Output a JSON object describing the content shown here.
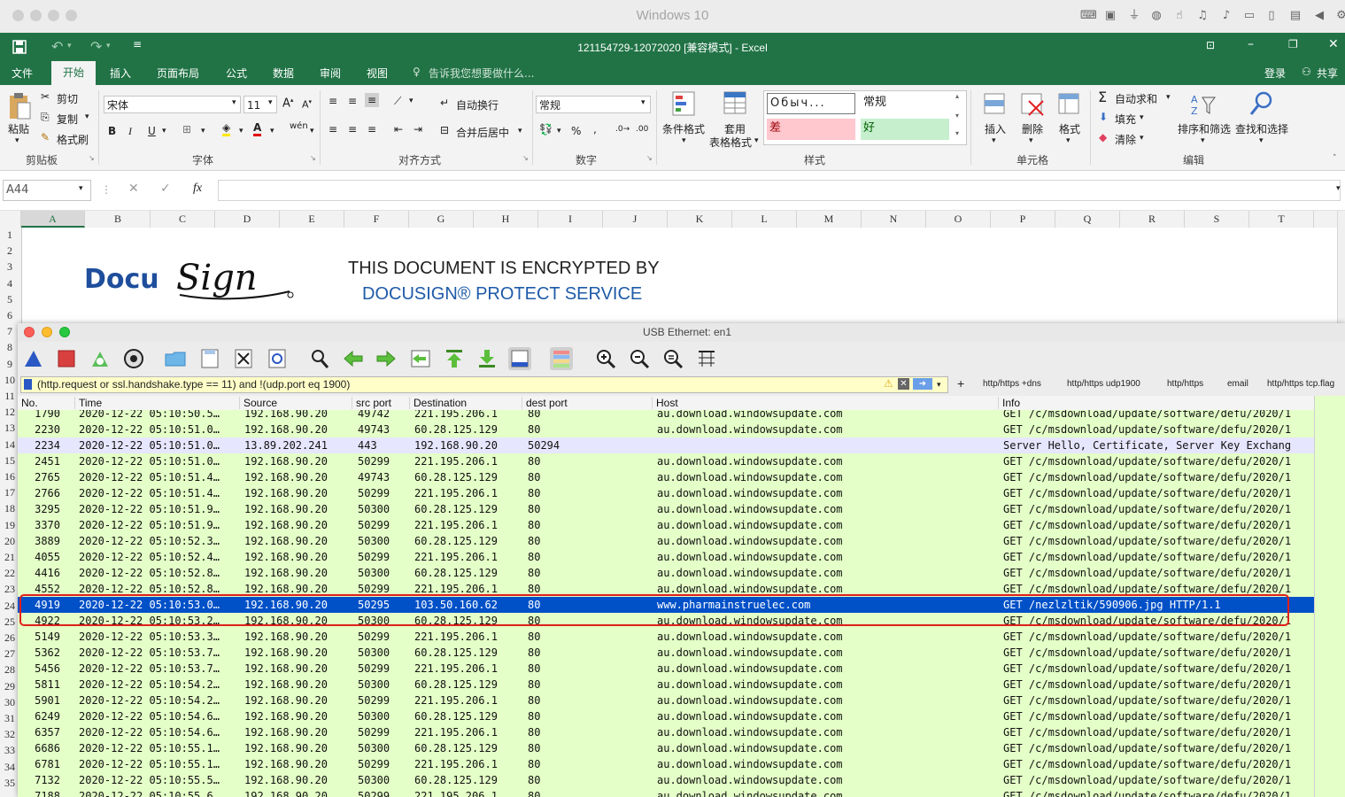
{
  "host": {
    "title": "Windows 10",
    "tray_icons": [
      "keyboard-icon",
      "cpu-icon",
      "usb-icon",
      "globe-icon",
      "touch-icon",
      "speaker-icon",
      "mic-icon",
      "tablet-icon",
      "display-icon",
      "folder-icon",
      "arrow-left-icon",
      "gear-icon"
    ]
  },
  "excel": {
    "window_title": "121154729-12072020  [兼容模式] - Excel",
    "tabs": [
      "文件",
      "开始",
      "插入",
      "页面布局",
      "公式",
      "数据",
      "审阅",
      "视图"
    ],
    "tell_me": "告诉我您想要做什么...",
    "login": "登录",
    "share": "共享",
    "ribbon": {
      "clipboard": {
        "paste": "粘贴",
        "cut": "剪切",
        "copy": "复制",
        "format_painter": "格式刷",
        "label": "剪贴板"
      },
      "font": {
        "name": "宋体",
        "size": "11",
        "bold": "B",
        "italic": "I",
        "underline": "U",
        "label": "字体"
      },
      "alignment": {
        "wrap": "自动换行",
        "merge": "合并后居中",
        "label": "对齐方式"
      },
      "number": {
        "format": "常规",
        "label": "数字"
      },
      "styles": {
        "conditional": "条件格式",
        "table_line1": "套用",
        "table_line2": "表格格式",
        "normal_ru": "Обыч...",
        "normal": "常规",
        "bad": "差",
        "good": "好",
        "label": "样式"
      },
      "cells": {
        "insert": "插入",
        "delete": "删除",
        "format": "格式",
        "label": "单元格"
      },
      "editing": {
        "autosum": "自动求和",
        "fill": "填充",
        "clear": "清除",
        "sort": "排序和筛选",
        "find": "查找和选择",
        "label": "编辑"
      }
    },
    "name_box": "A44",
    "fx": "fx",
    "columns": [
      "A",
      "B",
      "C",
      "D",
      "E",
      "F",
      "G",
      "H",
      "I",
      "J",
      "K",
      "L",
      "M",
      "N",
      "O",
      "P",
      "Q",
      "R",
      "S",
      "T"
    ],
    "rows": [
      "1",
      "2",
      "3",
      "4",
      "5",
      "6",
      "7",
      "8",
      "9",
      "10",
      "11",
      "12",
      "13",
      "14",
      "15",
      "16",
      "17",
      "18",
      "19",
      "20",
      "21",
      "22",
      "23",
      "24",
      "25",
      "26",
      "27",
      "28",
      "29",
      "30",
      "31",
      "32",
      "33",
      "34",
      "35"
    ],
    "docusign": {
      "logo_text": "DocuSign",
      "line1": "THIS DOCUMENT IS ENCRYPTED BY",
      "line2": "DOCUSIGN® PROTECT SERVICE"
    }
  },
  "wireshark": {
    "title": "USB Ethernet: en1",
    "filter": "(http.request or ssl.handshake.type == 11) and !(udp.port eq 1900)",
    "filter_buttons": [
      "http/https +dns",
      "http/https udp1900",
      "http/https",
      "email",
      "http/https tcp.flag"
    ],
    "columns": [
      "No.",
      "Time",
      "Source",
      "src port",
      "Destination",
      "dest port",
      "Host",
      "Info"
    ],
    "packets": [
      {
        "no": "1790",
        "time": "2020-12-22 05:10:50.5…",
        "src": "192.168.90.20",
        "sport": "49742",
        "dst": "221.195.206.1",
        "dport": "80",
        "host": "au.download.windowsupdate.com",
        "info": "GET /c/msdownload/update/software/defu/2020/1",
        "kind": "http"
      },
      {
        "no": "2230",
        "time": "2020-12-22 05:10:51.0…",
        "src": "192.168.90.20",
        "sport": "49743",
        "dst": "60.28.125.129",
        "dport": "80",
        "host": "au.download.windowsupdate.com",
        "info": "GET /c/msdownload/update/software/defu/2020/1",
        "kind": "http"
      },
      {
        "no": "2234",
        "time": "2020-12-22 05:10:51.0…",
        "src": "13.89.202.241",
        "sport": "443",
        "dst": "192.168.90.20",
        "dport": "50294",
        "host": "",
        "info": "Server Hello, Certificate, Server Key Exchang",
        "kind": "tls"
      },
      {
        "no": "2451",
        "time": "2020-12-22 05:10:51.0…",
        "src": "192.168.90.20",
        "sport": "50299",
        "dst": "221.195.206.1",
        "dport": "80",
        "host": "au.download.windowsupdate.com",
        "info": "GET /c/msdownload/update/software/defu/2020/1",
        "kind": "http"
      },
      {
        "no": "2765",
        "time": "2020-12-22 05:10:51.4…",
        "src": "192.168.90.20",
        "sport": "49743",
        "dst": "60.28.125.129",
        "dport": "80",
        "host": "au.download.windowsupdate.com",
        "info": "GET /c/msdownload/update/software/defu/2020/1",
        "kind": "http"
      },
      {
        "no": "2766",
        "time": "2020-12-22 05:10:51.4…",
        "src": "192.168.90.20",
        "sport": "50299",
        "dst": "221.195.206.1",
        "dport": "80",
        "host": "au.download.windowsupdate.com",
        "info": "GET /c/msdownload/update/software/defu/2020/1",
        "kind": "http"
      },
      {
        "no": "3295",
        "time": "2020-12-22 05:10:51.9…",
        "src": "192.168.90.20",
        "sport": "50300",
        "dst": "60.28.125.129",
        "dport": "80",
        "host": "au.download.windowsupdate.com",
        "info": "GET /c/msdownload/update/software/defu/2020/1",
        "kind": "http"
      },
      {
        "no": "3370",
        "time": "2020-12-22 05:10:51.9…",
        "src": "192.168.90.20",
        "sport": "50299",
        "dst": "221.195.206.1",
        "dport": "80",
        "host": "au.download.windowsupdate.com",
        "info": "GET /c/msdownload/update/software/defu/2020/1",
        "kind": "http"
      },
      {
        "no": "3889",
        "time": "2020-12-22 05:10:52.3…",
        "src": "192.168.90.20",
        "sport": "50300",
        "dst": "60.28.125.129",
        "dport": "80",
        "host": "au.download.windowsupdate.com",
        "info": "GET /c/msdownload/update/software/defu/2020/1",
        "kind": "http"
      },
      {
        "no": "4055",
        "time": "2020-12-22 05:10:52.4…",
        "src": "192.168.90.20",
        "sport": "50299",
        "dst": "221.195.206.1",
        "dport": "80",
        "host": "au.download.windowsupdate.com",
        "info": "GET /c/msdownload/update/software/defu/2020/1",
        "kind": "http"
      },
      {
        "no": "4416",
        "time": "2020-12-22 05:10:52.8…",
        "src": "192.168.90.20",
        "sport": "50300",
        "dst": "60.28.125.129",
        "dport": "80",
        "host": "au.download.windowsupdate.com",
        "info": "GET /c/msdownload/update/software/defu/2020/1",
        "kind": "http"
      },
      {
        "no": "4552",
        "time": "2020-12-22 05:10:52.8…",
        "src": "192.168.90.20",
        "sport": "50299",
        "dst": "221.195.206.1",
        "dport": "80",
        "host": "au.download.windowsupdate.com",
        "info": "GET /c/msdownload/update/software/defu/2020/1",
        "kind": "http"
      },
      {
        "no": "4919",
        "time": "2020-12-22 05:10:53.0…",
        "src": "192.168.90.20",
        "sport": "50295",
        "dst": "103.50.160.62",
        "dport": "80",
        "host": "www.pharmainstruelec.com",
        "info": "GET /nezlzltik/590906.jpg HTTP/1.1",
        "kind": "sel"
      },
      {
        "no": "4922",
        "time": "2020-12-22 05:10:53.2…",
        "src": "192.168.90.20",
        "sport": "50300",
        "dst": "60.28.125.129",
        "dport": "80",
        "host": "au.download.windowsupdate.com",
        "info": "GET /c/msdownload/update/software/defu/2020/1",
        "kind": "http"
      },
      {
        "no": "5149",
        "time": "2020-12-22 05:10:53.3…",
        "src": "192.168.90.20",
        "sport": "50299",
        "dst": "221.195.206.1",
        "dport": "80",
        "host": "au.download.windowsupdate.com",
        "info": "GET /c/msdownload/update/software/defu/2020/1",
        "kind": "http"
      },
      {
        "no": "5362",
        "time": "2020-12-22 05:10:53.7…",
        "src": "192.168.90.20",
        "sport": "50300",
        "dst": "60.28.125.129",
        "dport": "80",
        "host": "au.download.windowsupdate.com",
        "info": "GET /c/msdownload/update/software/defu/2020/1",
        "kind": "http"
      },
      {
        "no": "5456",
        "time": "2020-12-22 05:10:53.7…",
        "src": "192.168.90.20",
        "sport": "50299",
        "dst": "221.195.206.1",
        "dport": "80",
        "host": "au.download.windowsupdate.com",
        "info": "GET /c/msdownload/update/software/defu/2020/1",
        "kind": "http"
      },
      {
        "no": "5811",
        "time": "2020-12-22 05:10:54.2…",
        "src": "192.168.90.20",
        "sport": "50300",
        "dst": "60.28.125.129",
        "dport": "80",
        "host": "au.download.windowsupdate.com",
        "info": "GET /c/msdownload/update/software/defu/2020/1",
        "kind": "http"
      },
      {
        "no": "5901",
        "time": "2020-12-22 05:10:54.2…",
        "src": "192.168.90.20",
        "sport": "50299",
        "dst": "221.195.206.1",
        "dport": "80",
        "host": "au.download.windowsupdate.com",
        "info": "GET /c/msdownload/update/software/defu/2020/1",
        "kind": "http"
      },
      {
        "no": "6249",
        "time": "2020-12-22 05:10:54.6…",
        "src": "192.168.90.20",
        "sport": "50300",
        "dst": "60.28.125.129",
        "dport": "80",
        "host": "au.download.windowsupdate.com",
        "info": "GET /c/msdownload/update/software/defu/2020/1",
        "kind": "http"
      },
      {
        "no": "6357",
        "time": "2020-12-22 05:10:54.6…",
        "src": "192.168.90.20",
        "sport": "50299",
        "dst": "221.195.206.1",
        "dport": "80",
        "host": "au.download.windowsupdate.com",
        "info": "GET /c/msdownload/update/software/defu/2020/1",
        "kind": "http"
      },
      {
        "no": "6686",
        "time": "2020-12-22 05:10:55.1…",
        "src": "192.168.90.20",
        "sport": "50300",
        "dst": "60.28.125.129",
        "dport": "80",
        "host": "au.download.windowsupdate.com",
        "info": "GET /c/msdownload/update/software/defu/2020/1",
        "kind": "http"
      },
      {
        "no": "6781",
        "time": "2020-12-22 05:10:55.1…",
        "src": "192.168.90.20",
        "sport": "50299",
        "dst": "221.195.206.1",
        "dport": "80",
        "host": "au.download.windowsupdate.com",
        "info": "GET /c/msdownload/update/software/defu/2020/1",
        "kind": "http"
      },
      {
        "no": "7132",
        "time": "2020-12-22 05:10:55.5…",
        "src": "192.168.90.20",
        "sport": "50300",
        "dst": "60.28.125.129",
        "dport": "80",
        "host": "au.download.windowsupdate.com",
        "info": "GET /c/msdownload/update/software/defu/2020/1",
        "kind": "http"
      },
      {
        "no": "7188",
        "time": "2020-12-22 05:10:55.6…",
        "src": "192.168.90.20",
        "sport": "50299",
        "dst": "221.195.206.1",
        "dport": "80",
        "host": "au.download.windowsupdate.com",
        "info": "GET /c/msdownload/update/software/defu/2020/1",
        "kind": "http"
      }
    ]
  },
  "colors": {
    "excel_green": "#217346",
    "http_row": "#e4ffc7",
    "tls_row": "#e7e6ff",
    "selected_row": "#0050c8",
    "highlight_box": "#e0201a",
    "filter_bg": "#fffdc8"
  }
}
